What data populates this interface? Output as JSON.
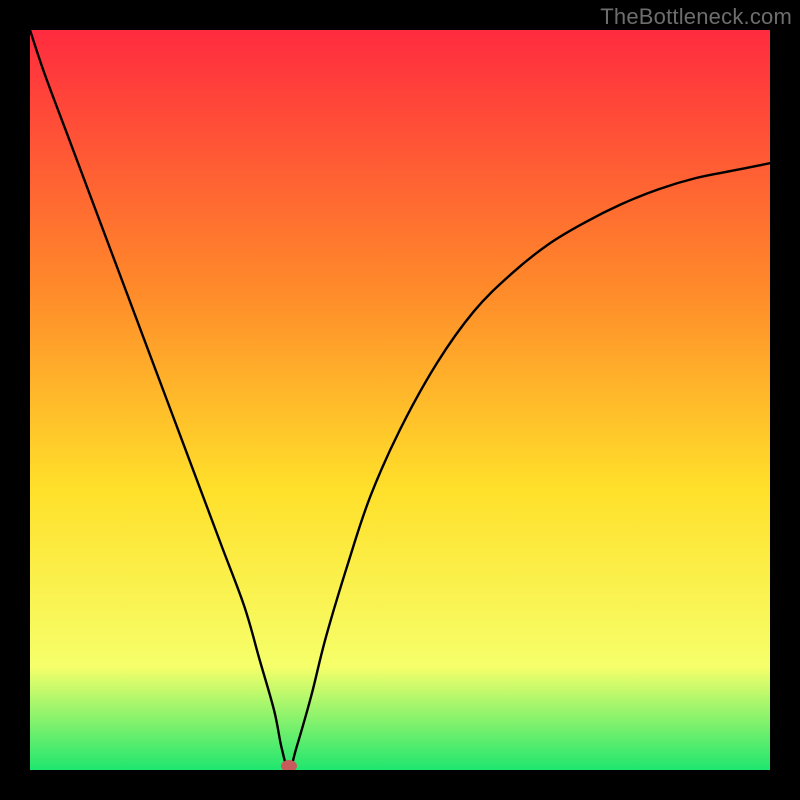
{
  "watermark": "TheBottleneck.com",
  "colors": {
    "frame": "#000000",
    "curve": "#000000",
    "marker": "#c75a5a",
    "gradient_top": "#ff2b3f",
    "gradient_mid1": "#ff8a2a",
    "gradient_mid2": "#ffe02a",
    "gradient_mid3": "#f6ff6a",
    "gradient_bottom": "#1ee66f"
  },
  "chart_data": {
    "type": "line",
    "title": "",
    "xlabel": "",
    "ylabel": "",
    "xlim": [
      0,
      100
    ],
    "ylim": [
      0,
      100
    ],
    "grid": false,
    "legend": false,
    "notch": {
      "x": 35,
      "y": 0
    },
    "series": [
      {
        "name": "curve",
        "x": [
          0,
          2,
          5,
          8,
          11,
          14,
          17,
          20,
          23,
          26,
          29,
          31,
          33,
          34,
          35,
          36,
          38,
          40,
          43,
          46,
          50,
          55,
          60,
          65,
          70,
          75,
          80,
          85,
          90,
          95,
          100
        ],
        "y": [
          100,
          94,
          86,
          78,
          70,
          62,
          54,
          46,
          38,
          30,
          22,
          15,
          8,
          3,
          0,
          3,
          10,
          18,
          28,
          37,
          46,
          55,
          62,
          67,
          71,
          74,
          76.5,
          78.5,
          80,
          81,
          82
        ]
      }
    ]
  }
}
